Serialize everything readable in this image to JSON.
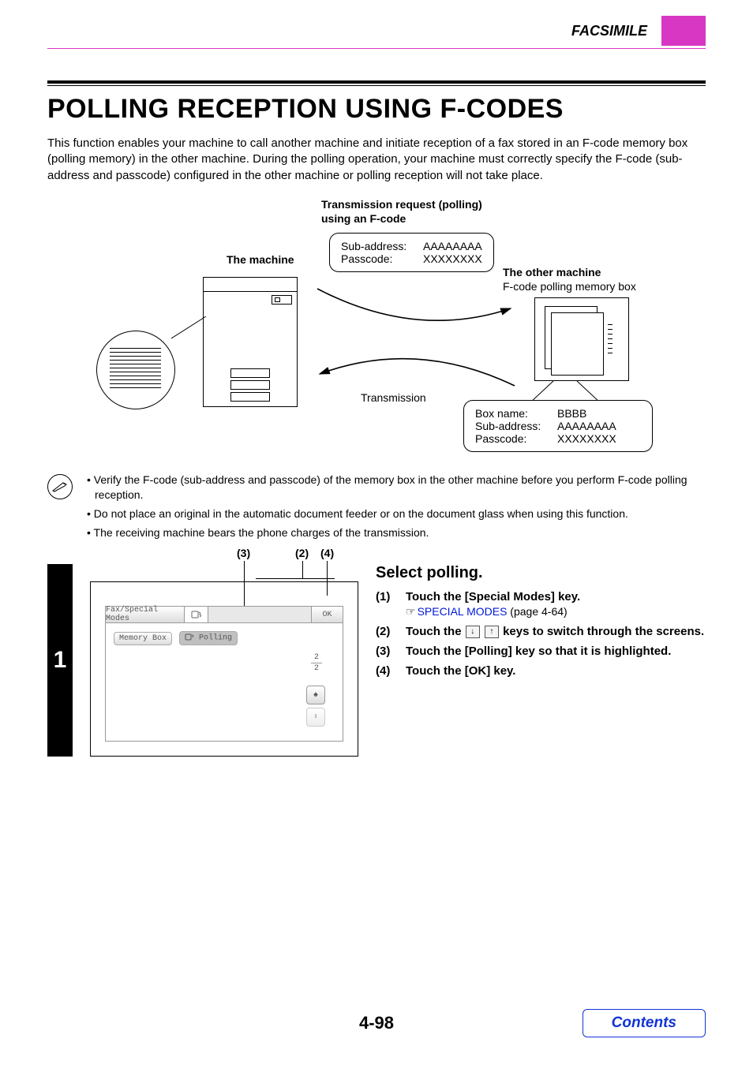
{
  "header": {
    "section": "FACSIMILE"
  },
  "title": "POLLING RECEPTION USING F-CODES",
  "intro": "This function enables your machine to call another machine and initiate reception of a fax stored in an F-code memory box (polling memory) in the other machine. During the polling operation, your machine must correctly specify the F-code (sub-address and passcode) configured in the other machine or polling reception will not take place.",
  "diagram": {
    "transmission_title1": "Transmission request (polling)",
    "transmission_title2": "using an F-code",
    "machine_label": "The machine",
    "other_machine_label": "The other machine",
    "other_machine_sub": "F-code polling memory box",
    "transmission_label": "Transmission",
    "info1_sub_label": "Sub-address:",
    "info1_sub_val": "AAAAAAAA",
    "info1_pass_label": "Passcode:",
    "info1_pass_val": "XXXXXXXX",
    "info2_box_label": "Box name:",
    "info2_box_val": "BBBB",
    "info2_sub_label": "Sub-address:",
    "info2_sub_val": "AAAAAAAA",
    "info2_pass_label": "Passcode:",
    "info2_pass_val": "XXXXXXXX"
  },
  "notes": [
    "Verify the F-code (sub-address and passcode) of the memory box in the other machine before you perform F-code polling reception.",
    "Do not place an original in the automatic document feeder or on the document glass when using this function.",
    "The receiving machine bears the phone charges of the transmission."
  ],
  "step": {
    "number": "1",
    "callouts": {
      "c3": "(3)",
      "c2": "(2)",
      "c4": "(4)"
    },
    "screen": {
      "header_label": "Fax/Special Modes",
      "ok_label": "OK",
      "memory_box": "Memory Box",
      "polling": "Polling",
      "page_cur": "2",
      "page_total": "2"
    },
    "heading": "Select polling.",
    "items": [
      {
        "num": "(1)",
        "text": "Touch the [Special Modes] key.",
        "sub_link": "SPECIAL MODES",
        "sub_rest": " (page 4-64)"
      },
      {
        "num": "(2)",
        "text_before": "Touch the ",
        "text_after": " keys to switch through the screens."
      },
      {
        "num": "(3)",
        "text": "Touch the [Polling] key so that it is highlighted."
      },
      {
        "num": "(4)",
        "text": "Touch the [OK] key."
      }
    ]
  },
  "footer": {
    "page": "4-98",
    "contents": "Contents"
  }
}
